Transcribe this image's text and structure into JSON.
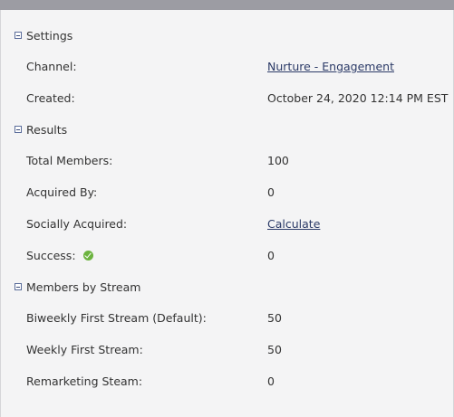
{
  "settings": {
    "title": "Settings",
    "channel_label": "Channel:",
    "channel_value": "Nurture - Engagement",
    "created_label": "Created:",
    "created_value": "October 24, 2020 12:14 PM EST"
  },
  "results": {
    "title": "Results",
    "total_members_label": "Total Members:",
    "total_members_value": "100",
    "acquired_by_label": "Acquired By:",
    "acquired_by_value": "0",
    "socially_acquired_label": "Socially Acquired:",
    "socially_acquired_value": "Calculate",
    "success_label": "Success:",
    "success_icon": "check-circle-icon",
    "success_value": "0"
  },
  "members_by_stream": {
    "title": "Members by Stream",
    "streams": [
      {
        "label": "Biweekly First Stream (Default):",
        "value": "50"
      },
      {
        "label": "Weekly First Stream:",
        "value": "50"
      },
      {
        "label": "Remarketing Steam:",
        "value": "0"
      }
    ]
  },
  "colors": {
    "link": "#2b3a67",
    "success": "#6cb33f",
    "panel_bg": "#f4f4f5",
    "top_bar": "#9c9ca3"
  }
}
